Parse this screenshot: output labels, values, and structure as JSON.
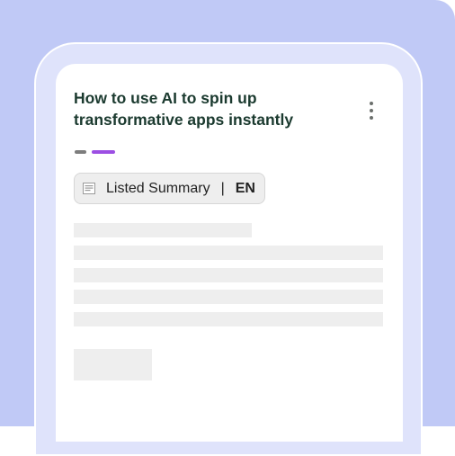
{
  "article": {
    "title": "How to use AI to spin up transformative apps instantly"
  },
  "menu": {
    "icon": "more-vert-icon"
  },
  "summary_chip": {
    "icon": "document-icon",
    "label": "Listed Summary",
    "separator": "|",
    "language": "EN"
  },
  "pager": {
    "count": 2,
    "active_index": 1,
    "active_color": "#9c4ee3",
    "inactive_color": "#7d7d7d"
  },
  "colors": {
    "background": "#c0c9f6",
    "frame": "#dfe3fb",
    "title": "#1b3a2f",
    "skeleton": "#eeeeee"
  }
}
